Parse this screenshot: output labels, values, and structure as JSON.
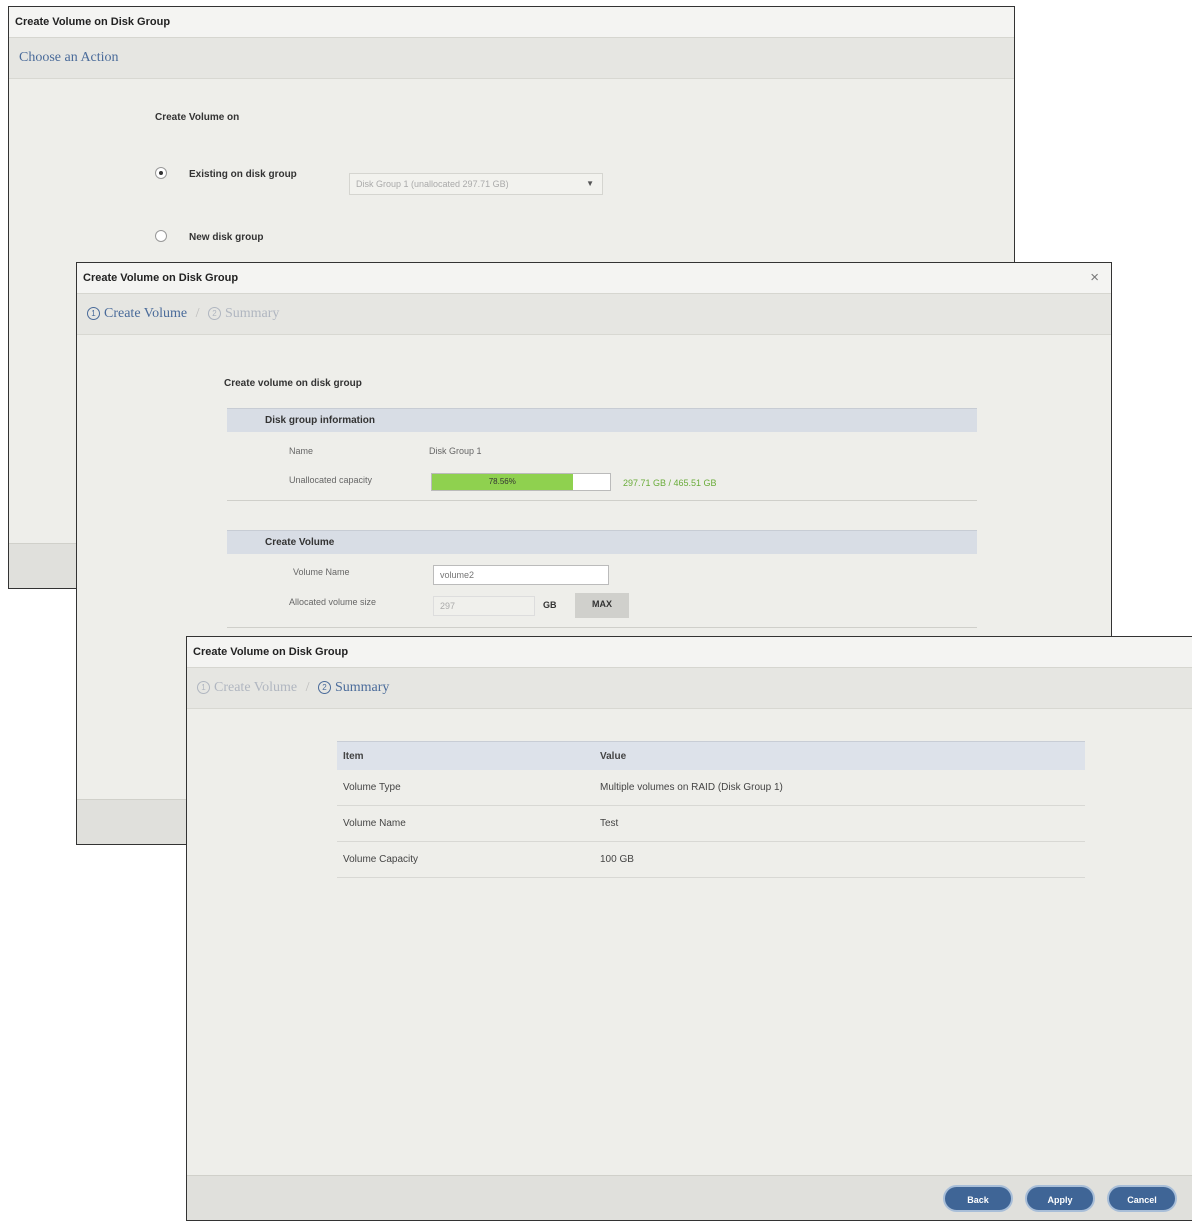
{
  "dialog1": {
    "title": "Create Volume on Disk Group",
    "breadcrumb": "Choose an Action",
    "create_on_label": "Create Volume on",
    "options": [
      {
        "label": "Existing on disk group",
        "selected": true
      },
      {
        "label": "New disk group",
        "selected": false
      }
    ],
    "disk_group_select": "Disk Group 1 (unallocated 297.71 GB)"
  },
  "dialog2": {
    "title": "Create Volume on Disk Group",
    "close": "×",
    "steps": [
      {
        "icon": "1",
        "label": "Create Volume",
        "active": true
      },
      {
        "icon": "2",
        "label": "Summary",
        "active": false
      }
    ],
    "breadcrumb_sep": "/",
    "heading": "Create volume on disk group",
    "info_section": {
      "title": "Disk group information",
      "name_label": "Name",
      "name_value": "Disk Group 1",
      "capacity_label": "Unallocated capacity",
      "capacity_percent": "78.56%",
      "capacity_fraction": 0.79,
      "capacity_text": "297.71 GB / 465.51 GB"
    },
    "create_section": {
      "title": "Create Volume",
      "name_label": "Volume Name",
      "name_placeholder": "volume2",
      "size_label": "Allocated volume size",
      "size_value": "297",
      "unit": "GB",
      "max_button": "MAX"
    }
  },
  "dialog3": {
    "title": "Create Volume on Disk Group",
    "steps": [
      {
        "icon": "1",
        "label": "Create Volume",
        "active": false
      },
      {
        "icon": "2",
        "label": "Summary",
        "active": true
      }
    ],
    "breadcrumb_sep": "/",
    "table": {
      "headers": [
        "Item",
        "Value"
      ],
      "rows": [
        [
          "Volume Type",
          "Multiple volumes on RAID (Disk Group 1)"
        ],
        [
          "Volume Name",
          "Test"
        ],
        [
          "Volume Capacity",
          "100 GB"
        ]
      ]
    },
    "buttons": {
      "back": "Back",
      "apply": "Apply",
      "cancel": "Cancel"
    }
  },
  "colors": {
    "accent_button": "#3f6596",
    "progress_fill": "#8fd14f",
    "breadcrumb_active": "#4a6b9a"
  }
}
